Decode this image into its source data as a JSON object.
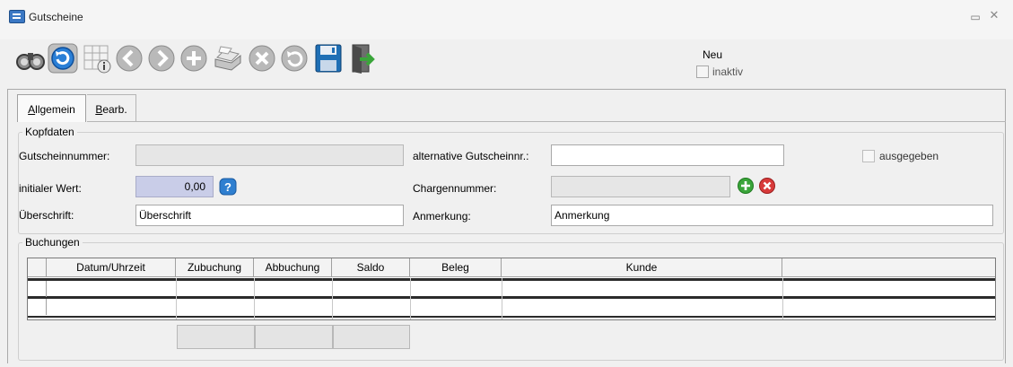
{
  "window": {
    "title": "Gutscheine",
    "minimize_icon": "minimize-icon",
    "close_icon": "close-icon"
  },
  "toolbar": {
    "buttons": [
      {
        "name": "search-button",
        "icon": "binoculars-icon"
      },
      {
        "name": "refresh-button",
        "icon": "refresh-icon"
      },
      {
        "name": "grid-info-button",
        "icon": "grid-info-icon"
      },
      {
        "name": "back-button",
        "icon": "arrow-left-icon"
      },
      {
        "name": "forward-button",
        "icon": "arrow-right-icon"
      },
      {
        "name": "add-button",
        "icon": "plus-icon"
      },
      {
        "name": "print-button",
        "icon": "printer-icon"
      },
      {
        "name": "cancel-button",
        "icon": "x-circle-icon"
      },
      {
        "name": "undo-button",
        "icon": "undo-icon"
      },
      {
        "name": "save-button",
        "icon": "floppy-icon"
      },
      {
        "name": "exit-button",
        "icon": "door-exit-icon"
      }
    ],
    "status": "Neu",
    "inaktiv_label": "inaktiv",
    "inaktiv_checked": false
  },
  "tabs": {
    "allgemein_u": "A",
    "allgemein_rest": "llgemein",
    "bearb_u": "B",
    "bearb_rest": "earb.",
    "active": "Allgemein"
  },
  "kopfdaten": {
    "legend": "Kopfdaten",
    "gutscheinnummer_label": "Gutscheinnummer:",
    "gutscheinnummer_value": "",
    "alt_label": "alternative Gutscheinnr.:",
    "alt_value": "",
    "ausgegeben_label": "ausgegeben",
    "ausgegeben_checked": false,
    "wert_label": "initialer Wert:",
    "wert_value": "0,00",
    "charge_label": "Chargennummer:",
    "charge_value": "",
    "ueber_label": "Überschrift:",
    "ueber_value": "Überschrift",
    "anmerkung_label": "Anmerkung:",
    "anmerkung_value": "Anmerkung"
  },
  "buchungen": {
    "legend": "Buchungen",
    "columns": [
      "Datum/Uhrzeit",
      "Zubuchung",
      "Abbuchung",
      "Saldo",
      "Beleg",
      "Kunde"
    ]
  },
  "colors": {
    "accent": "#3b78c4",
    "highlight_field": "#c9cde8",
    "add": "#3aa53a",
    "delete": "#d83a3a"
  }
}
